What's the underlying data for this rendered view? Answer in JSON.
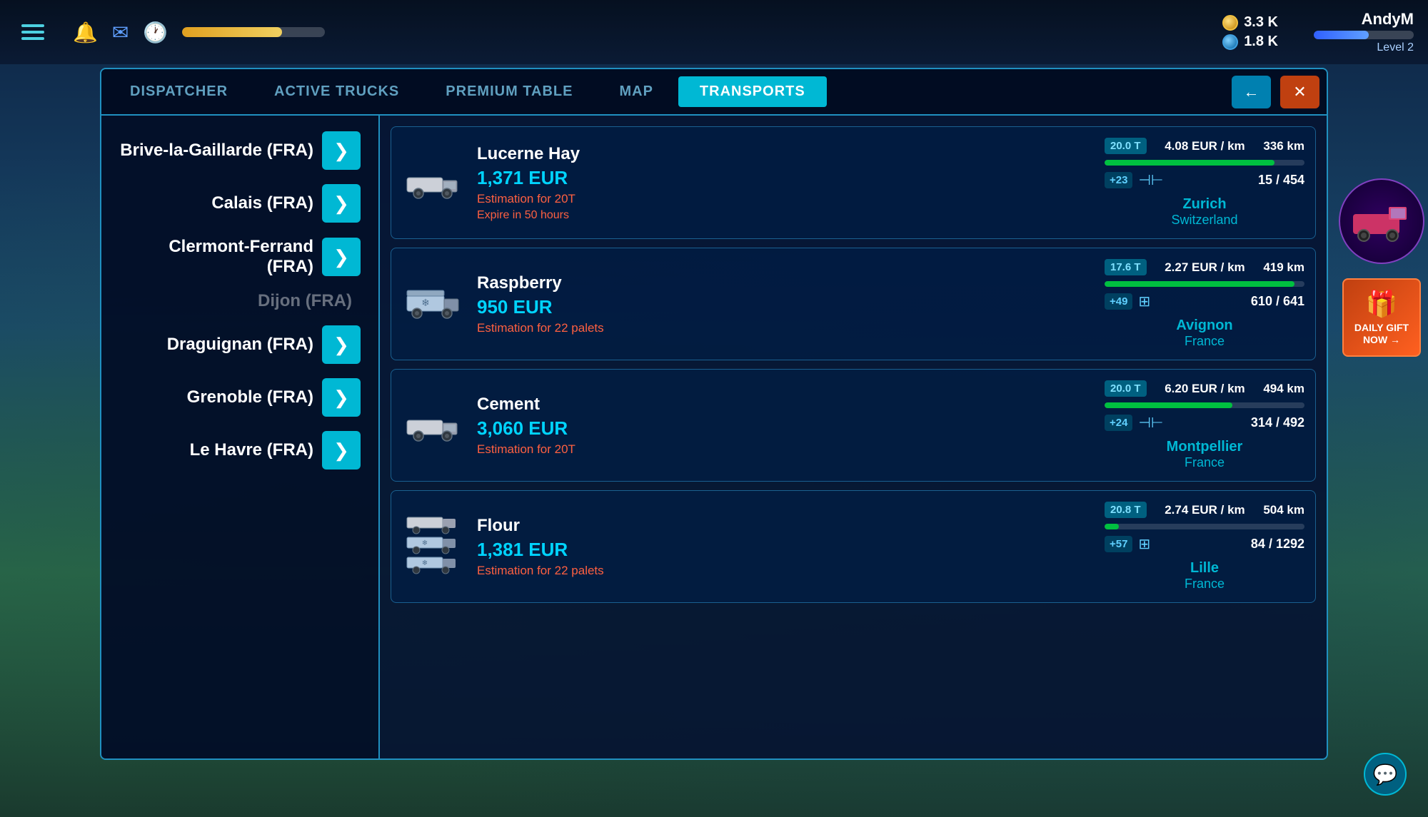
{
  "topbar": {
    "currency1_label": "3.3 K",
    "currency2_label": "1.8 K",
    "player_name": "AndyM",
    "player_level": "Level 2",
    "xp_percent": 70
  },
  "tabs": {
    "items": [
      {
        "id": "dispatcher",
        "label": "DISPATCHER",
        "active": false
      },
      {
        "id": "active-trucks",
        "label": "ACTIVE TRUCKS",
        "active": false
      },
      {
        "id": "premium-table",
        "label": "PREMIUM TABLE",
        "active": false
      },
      {
        "id": "map",
        "label": "MAP",
        "active": false
      },
      {
        "id": "transports",
        "label": "TRANSPORTS",
        "active": true
      }
    ],
    "back_label": "←",
    "close_label": "✕"
  },
  "cities": [
    {
      "name": "Brive-la-Gaillarde (FRA)",
      "has_arrow": true
    },
    {
      "name": "Calais (FRA)",
      "has_arrow": true
    },
    {
      "name": "Clermont-Ferrand (FRA)",
      "has_arrow": true
    },
    {
      "name": "Dijon (FRA)",
      "has_arrow": false
    },
    {
      "name": "Draguignan (FRA)",
      "has_arrow": true
    },
    {
      "name": "Grenoble (FRA)",
      "has_arrow": true
    },
    {
      "name": "Le Havre (FRA)",
      "has_arrow": true
    }
  ],
  "transports": [
    {
      "name": "Lucerne Hay",
      "price": "1,371 EUR",
      "estimate": "Estimation for 20T",
      "expire": "Expire in 50 hours",
      "weight": "20.0 T",
      "rate": "4.08 EUR / km",
      "distance": "336 km",
      "progress_pct": 85,
      "plus_val": "+23",
      "capacity_type": "connector",
      "slots": "15 / 454",
      "dest_city": "Zurich",
      "dest_country": "Switzerland",
      "truck_type": "flat"
    },
    {
      "name": "Raspberry",
      "price": "950 EUR",
      "estimate": "Estimation for 22 palets",
      "expire": "",
      "weight": "17.6 T",
      "rate": "2.27 EUR / km",
      "distance": "419 km",
      "progress_pct": 95,
      "plus_val": "+49",
      "capacity_type": "solar",
      "slots": "610 / 641",
      "dest_city": "Avignon",
      "dest_country": "France",
      "truck_type": "refrig"
    },
    {
      "name": "Cement",
      "price": "3,060 EUR",
      "estimate": "Estimation for 20T",
      "expire": "",
      "weight": "20.0 T",
      "rate": "6.20 EUR / km",
      "distance": "494 km",
      "progress_pct": 64,
      "plus_val": "+24",
      "capacity_type": "connector",
      "slots": "314 / 492",
      "dest_city": "Montpellier",
      "dest_country": "France",
      "truck_type": "flat"
    },
    {
      "name": "Flour",
      "price": "1,381 EUR",
      "estimate": "Estimation for 22 palets",
      "expire": "",
      "weight": "20.8 T",
      "rate": "2.74 EUR / km",
      "distance": "504 km",
      "progress_pct": 7,
      "plus_val": "+57",
      "capacity_type": "solar",
      "slots": "84 / 1292",
      "dest_city": "Lille",
      "dest_country": "France",
      "truck_type": "multi"
    }
  ],
  "daily_gift": {
    "label": "DAILY GIFT NOW",
    "arrow": "→"
  },
  "chat_icon": "💬"
}
